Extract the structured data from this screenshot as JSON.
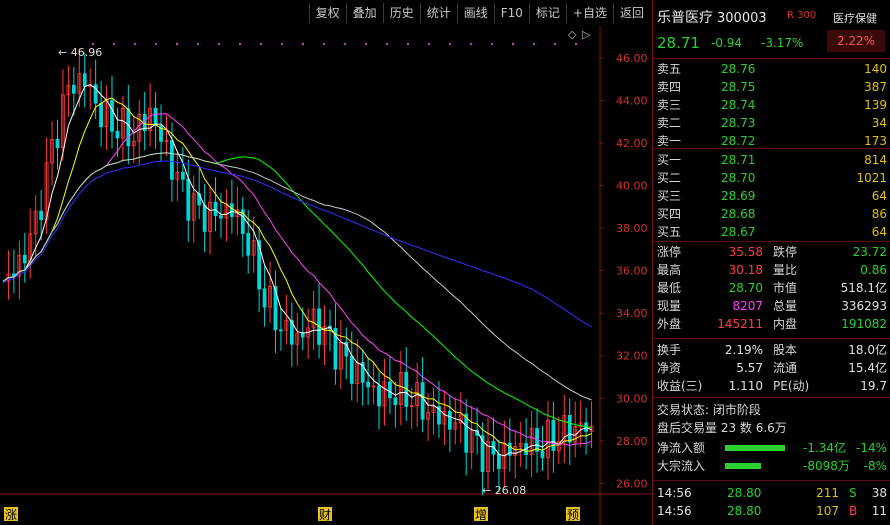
{
  "toolbar": {
    "items": [
      "复权",
      "叠加",
      "历史",
      "统计",
      "画线",
      "F10",
      "标记",
      "+自选",
      "返回"
    ]
  },
  "chart": {
    "y_axis_labels": [
      "46.00",
      "44.00",
      "42.00",
      "40.00",
      "38.00",
      "36.00",
      "34.00",
      "32.00",
      "30.00",
      "28.00",
      "26.00"
    ],
    "high_annotation": "46.96",
    "low_annotation": "26.08",
    "event_markers": [
      "涨",
      "财",
      "增",
      "预"
    ],
    "top_right_symbols": [
      "◇",
      "▷"
    ],
    "colors": {
      "up": "#ff3b3b",
      "down": "#00d6d6",
      "ma5": "#ffffff",
      "ma10": "#ffff00",
      "ma20": "#ff40ff",
      "ma60": "#00ff00",
      "ma120": "#c8c8c8",
      "ma250": "#3030ff"
    }
  },
  "chart_data": {
    "type": "line",
    "title": "",
    "ylim": [
      25.5,
      47.5
    ],
    "series": [
      {
        "values": [
          35.5,
          36.2,
          38.0,
          41.5,
          44.5,
          45.0,
          43.5,
          43.0,
          42.5,
          43.5,
          41.5,
          39.5,
          38.5,
          38.5,
          39.0,
          37.5,
          35.0,
          33.5,
          32.8,
          33.5,
          32.5,
          31.5,
          30.8,
          30.2,
          30.5,
          30.3,
          29.5,
          29.0,
          28.5,
          27.5,
          27.0,
          27.5,
          28.0,
          28.0,
          28.5,
          28.7,
          28.7
        ]
      }
    ]
  },
  "quote": {
    "name": "乐普医疗",
    "code": "300003",
    "rbadge": "R 300",
    "price": "28.71",
    "change": "-0.94",
    "pct": "-3.17%",
    "concept": "医疗保健",
    "concept_value": "2.22%"
  },
  "asks": [
    {
      "label": "卖五",
      "price": "28.76",
      "vol": "140"
    },
    {
      "label": "卖四",
      "price": "28.75",
      "vol": "387"
    },
    {
      "label": "卖三",
      "price": "28.74",
      "vol": "139"
    },
    {
      "label": "卖二",
      "price": "28.73",
      "vol": "34"
    },
    {
      "label": "卖一",
      "price": "28.72",
      "vol": "173"
    }
  ],
  "bids": [
    {
      "label": "买一",
      "price": "28.71",
      "vol": "814"
    },
    {
      "label": "买二",
      "price": "28.70",
      "vol": "1021"
    },
    {
      "label": "买三",
      "price": "28.69",
      "vol": "64"
    },
    {
      "label": "买四",
      "price": "28.68",
      "vol": "86"
    },
    {
      "label": "买五",
      "price": "28.67",
      "vol": "64"
    }
  ],
  "stats": [
    {
      "a": "涨停",
      "b": "35.58",
      "bc": "red",
      "c": "跌停",
      "d": "23.72",
      "dc": "grn"
    },
    {
      "a": "最高",
      "b": "30.18",
      "bc": "red",
      "c": "量比",
      "d": "0.86",
      "dc": "grn"
    },
    {
      "a": "最低",
      "b": "28.70",
      "bc": "grn",
      "c": "市值",
      "d": "518.1亿",
      "dc": "wht"
    },
    {
      "a": "现量",
      "b": "8207",
      "bc": "mag",
      "c": "总量",
      "d": "336293",
      "dc": "wht"
    },
    {
      "a": "外盘",
      "b": "145211",
      "bc": "red",
      "c": "内盘",
      "d": "191082",
      "dc": "grn"
    }
  ],
  "stats2": [
    {
      "a": "换手",
      "b": "2.19%",
      "bc": "wht",
      "c": "股本",
      "d": "18.0亿",
      "dc": "wht"
    },
    {
      "a": "净资",
      "b": "5.57",
      "bc": "wht",
      "c": "流通",
      "d": "15.4亿",
      "dc": "wht"
    },
    {
      "a": "收益(三)",
      "b": "1.110",
      "bc": "wht",
      "c": "PE(动)",
      "d": "19.7",
      "dc": "wht"
    }
  ],
  "trade_status": "交易状态: 闭市阶段",
  "after_hours": "盘后交易量 23 数  6.6万",
  "flows": [
    {
      "label": "净流入额",
      "value": "-1.34亿",
      "pct": "-14%",
      "fill": 0.75
    },
    {
      "label": "大宗流入",
      "value": "-8098万",
      "pct": "-8%",
      "fill": 0.45
    }
  ],
  "ticks": [
    {
      "time": "14:56",
      "price": "28.80",
      "vol": "211",
      "side": "S",
      "sc": "grn",
      "n": "38"
    },
    {
      "time": "14:56",
      "price": "28.80",
      "vol": "107",
      "side": "B",
      "sc": "red",
      "n": "11"
    }
  ]
}
